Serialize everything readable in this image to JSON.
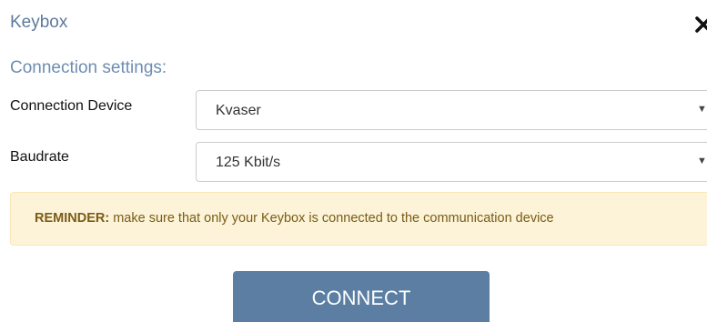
{
  "dialog": {
    "title": "Keybox",
    "close_icon": "close-icon"
  },
  "section": {
    "title": "Connection settings:"
  },
  "fields": {
    "device": {
      "label": "Connection Device",
      "value": "Kvaser"
    },
    "baudrate": {
      "label": "Baudrate",
      "value": "125 Kbit/s"
    }
  },
  "reminder": {
    "prefix": "REMINDER:",
    "text": "make sure that only your Keybox is connected to the communication device"
  },
  "connect_button": {
    "label": "CONNECT"
  },
  "colors": {
    "title": "#5b7a9c",
    "button": "#5b7ea2",
    "reminder_background": "#fcf3d8",
    "reminder_text": "#7a5c16"
  }
}
